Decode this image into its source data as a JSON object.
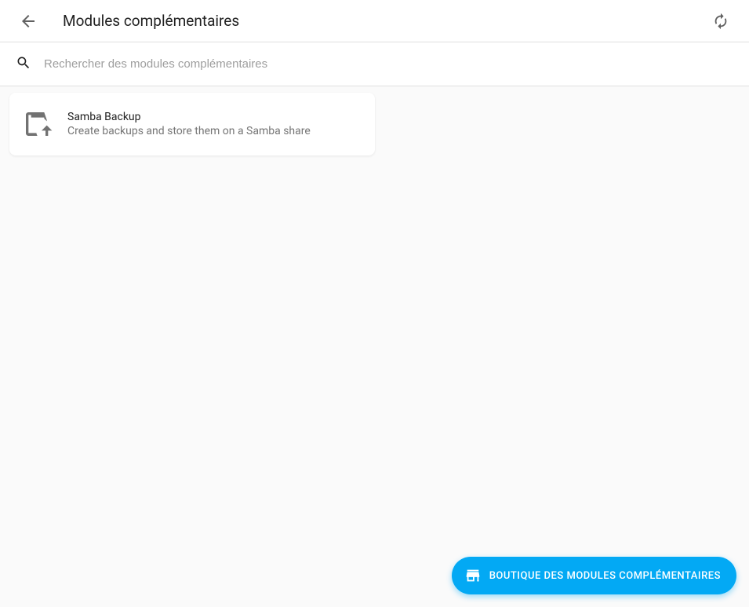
{
  "header": {
    "title": "Modules complémentaires"
  },
  "search": {
    "placeholder": "Rechercher des modules complémentaires"
  },
  "addons": [
    {
      "title": "Samba Backup",
      "description": "Create backups and store them on a Samba share"
    }
  ],
  "fab": {
    "label": "BOUTIQUE DES MODULES COMPLÉMENTAIRES"
  }
}
